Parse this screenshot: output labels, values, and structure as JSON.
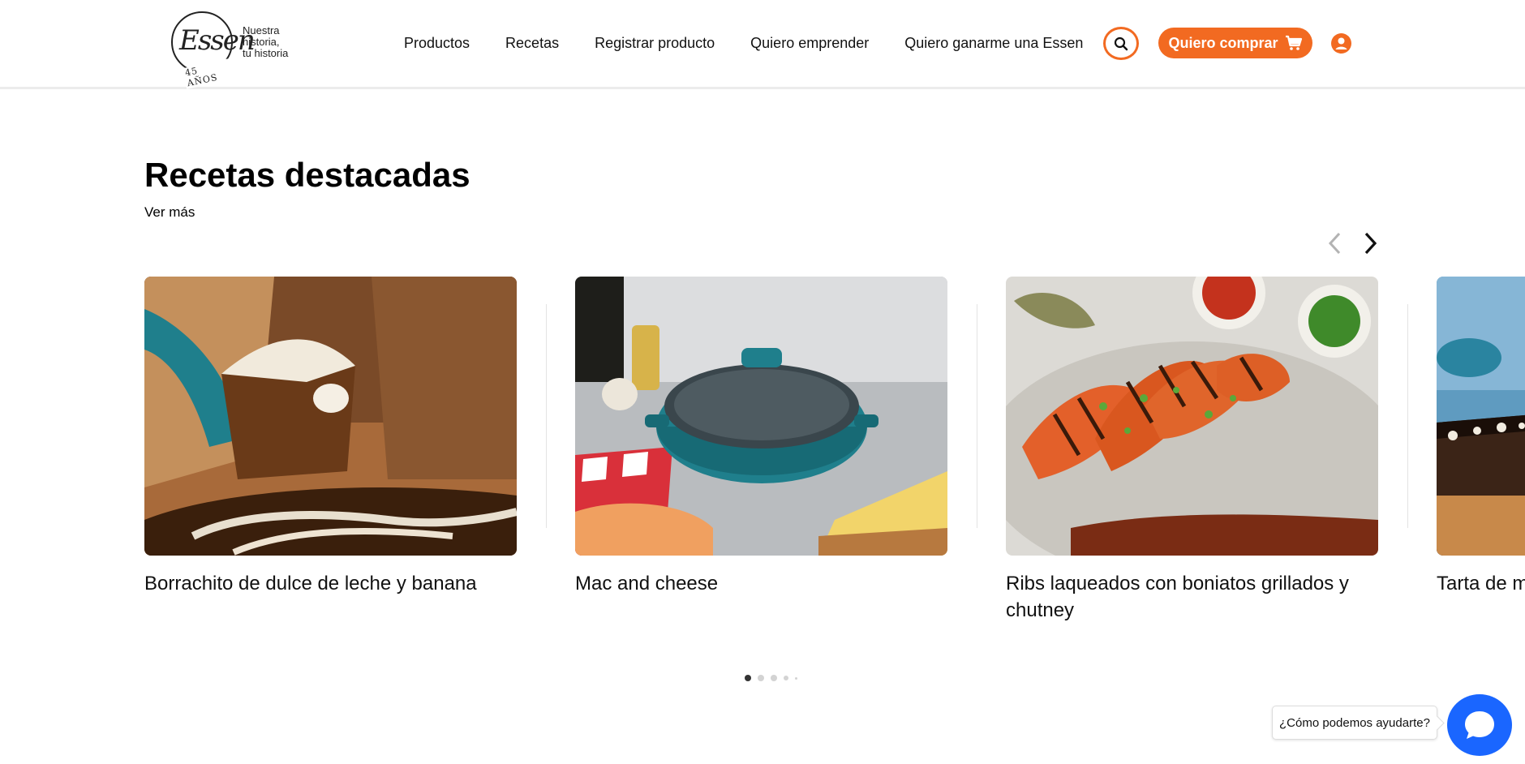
{
  "header": {
    "logo": {
      "brand": "Essen",
      "years": "45 AÑOS",
      "tagline": [
        "Nuestra",
        "historia,",
        "tu historia"
      ]
    },
    "nav": [
      {
        "label": "Productos"
      },
      {
        "label": "Recetas"
      },
      {
        "label": "Registrar producto"
      },
      {
        "label": "Quiero emprender"
      },
      {
        "label": "Quiero ganarme una Essen"
      }
    ],
    "search_icon": "search-icon",
    "buy_button": {
      "label": "Quiero comprar",
      "icon": "cart-icon"
    },
    "user_icon": "user-icon"
  },
  "section": {
    "title": "Recetas destacadas",
    "see_more": "Ver más"
  },
  "carousel": {
    "prev_icon": "chevron-left-icon",
    "next_icon": "chevron-right-icon",
    "cards": [
      {
        "title": "Borrachito de dulce de leche y banana",
        "image": "dessert-on-spatula-photo"
      },
      {
        "title": "Mac and cheese",
        "image": "teal-pot-with-cheese-photo"
      },
      {
        "title": "Ribs laqueados con boniatos grillados y chutney",
        "image": "grilled-sweet-potatoes-photo"
      },
      {
        "title": "Tarta de m rojos",
        "image": "tart-photo"
      }
    ],
    "pagination": {
      "total": 5,
      "active": 1
    }
  },
  "chat": {
    "help_text": "¿Cómo podemos ayudarte?",
    "icon": "chat-icon"
  },
  "colors": {
    "accent": "#f26a21",
    "chat": "#1a66ff",
    "teal": "#1f7f8c"
  }
}
